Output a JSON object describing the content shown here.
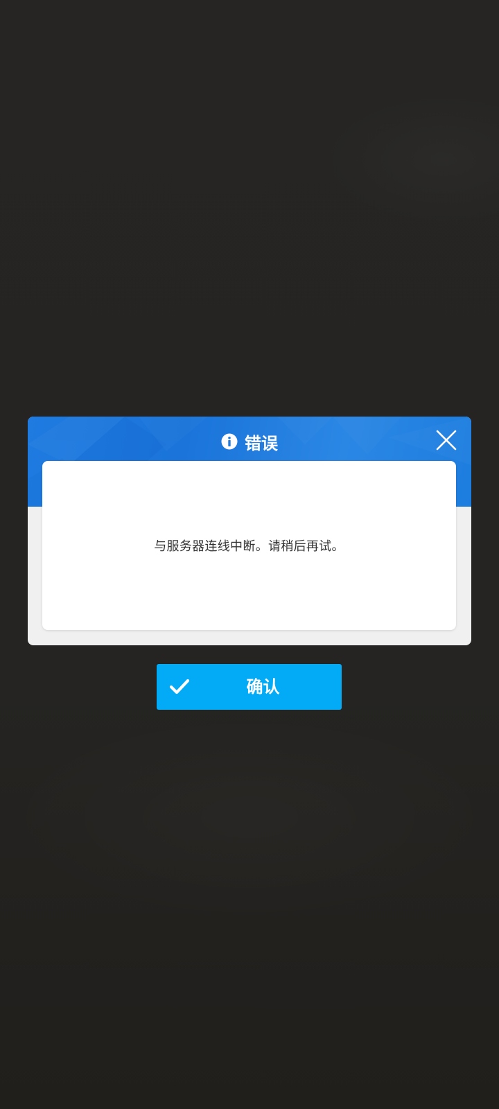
{
  "dialog": {
    "title": "错误",
    "title_icon": "info-icon",
    "close_icon": "close-icon",
    "message": "与服务器连线中断。请稍后再试。"
  },
  "confirm_button": {
    "label": "确认",
    "icon": "checkmark-icon"
  },
  "colors": {
    "header_blue": "#1f7be0",
    "confirm_blue": "#03aaf6",
    "backdrop": "#262523",
    "dialog_gray": "#f0f0f0"
  }
}
